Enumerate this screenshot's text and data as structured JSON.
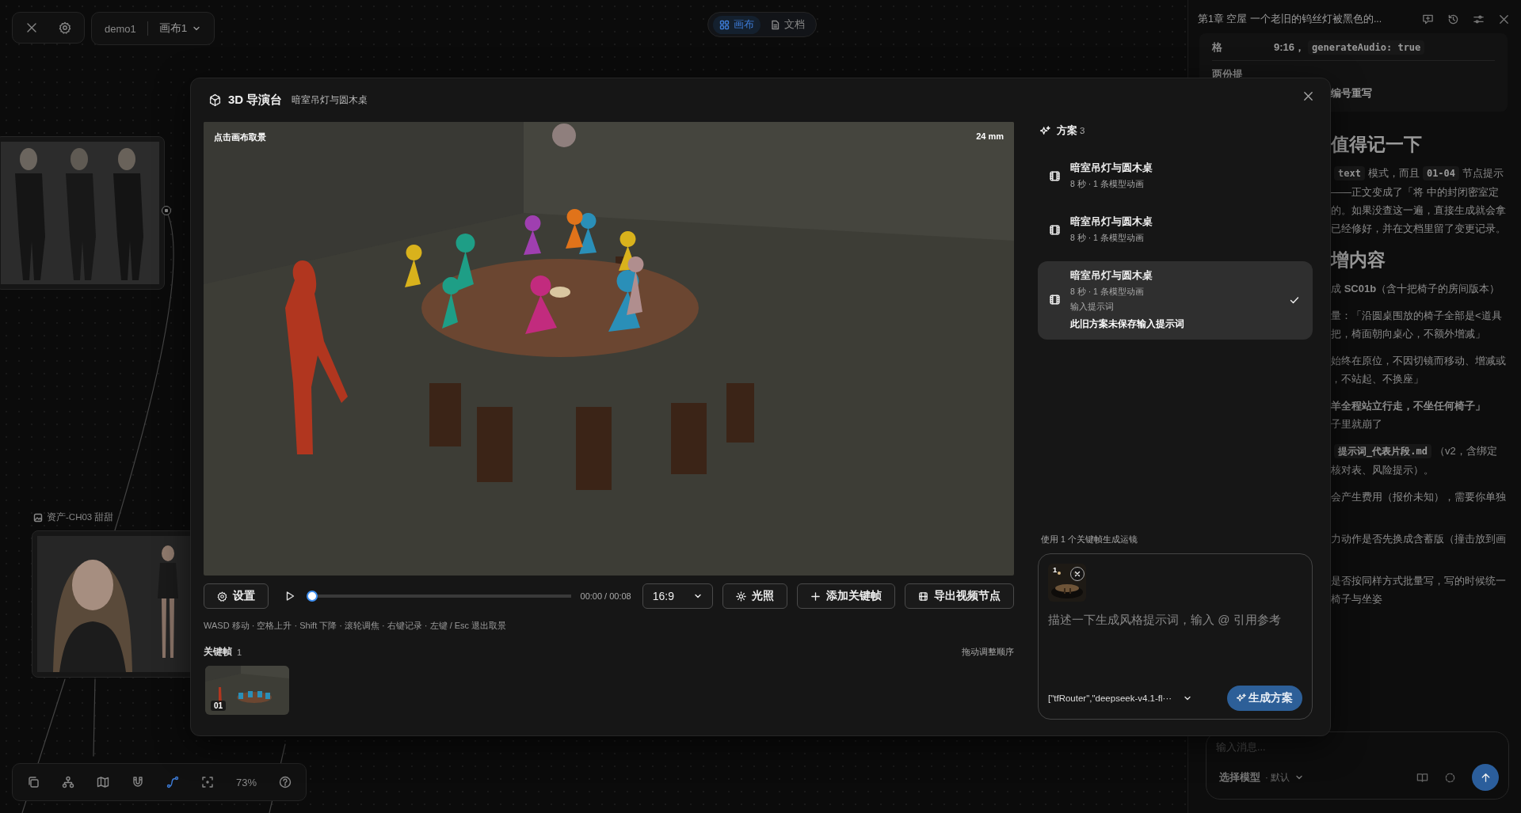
{
  "canvas": {
    "project": {
      "name": "demo1",
      "canvas": "画布1"
    },
    "view_tabs": [
      {
        "label": "画布",
        "kind": "canvas",
        "selected": true
      },
      {
        "label": "文档",
        "kind": "document",
        "selected": false
      }
    ],
    "asset_node": {
      "label": "资产-CH03 甜甜"
    },
    "toolbar": {
      "tools": [
        {
          "kind": "pages",
          "selected": false
        },
        {
          "kind": "tree",
          "selected": false
        },
        {
          "kind": "map",
          "selected": false
        },
        {
          "kind": "magnet",
          "selected": false
        },
        {
          "kind": "path",
          "selected": true
        },
        {
          "kind": "focus",
          "selected": false
        }
      ],
      "zoom": "73%"
    }
  },
  "modal": {
    "title": "3D 导演台",
    "subtitle": "暗室吊灯与圆木桌",
    "viewport": {
      "hint": "点击画布取景",
      "focal": "24 mm"
    },
    "controls": {
      "settings": "设置",
      "level": 0,
      "time": "00:00 / 00:08",
      "aspect": "16:9",
      "lighting": "光照",
      "add_keyframe": "添加关键帧",
      "export": "导出视频节点"
    },
    "shortcuts": "WASD 移动 · 空格上升 · Shift 下降 · 滚轮调焦 · 右键记录 · 左键 / Esc 退出取景",
    "keyframes": {
      "title": "关键帧",
      "count": "1",
      "hint": "拖动调整顺序",
      "items": [
        {
          "label": "01"
        }
      ]
    },
    "schemes": {
      "title": "方案",
      "count": "3",
      "items": [
        {
          "title": "暗室吊灯与圆木桌",
          "meta": "8 秒 · 1 条模型动画",
          "selected": false
        },
        {
          "title": "暗室吊灯与圆木桌",
          "meta": "8 秒 · 1 条模型动画",
          "selected": false
        },
        {
          "title": "暗室吊灯与圆木桌",
          "meta": "8 秒 · 1 条模型动画",
          "prompt_label": "输入提示词",
          "note": "此旧方案未保存输入提示词",
          "selected": true
        }
      ]
    },
    "composer": {
      "caption": "使用 1 个关键帧生成运镜",
      "attachments": [
        {
          "badge": "1"
        }
      ],
      "placeholder": "描述一下生成风格提示词，输入 @ 引用参考",
      "model": "[\"tfRouter\",\"deepseek-v4.1-fl···",
      "submit": "生成方案"
    }
  },
  "document": {
    "title": "第1章 空屋 一个老旧的钨丝灯被黑色的...",
    "table": [
      {
        "kind": "inline",
        "label": "格",
        "parts": [
          {
            "text": "9:16，",
            "code": false
          },
          {
            "text": "generateAudio: true",
            "code": true
          }
        ]
      },
      {
        "kind": "stacked",
        "label": "两份提",
        "parts": [
          {
            "text": "编号重写",
            "code": false
          }
        ]
      }
    ],
    "blocks": [
      {
        "kind": "heading",
        "text": "值得记一下"
      },
      {
        "kind": "paragraph",
        "lines": [
          [
            {
              "text": "text",
              "code": true
            },
            {
              "text": "模式，而且",
              "code": false
            },
            {
              "text": "01-04",
              "code": true
            },
            {
              "text": "节点提示",
              "code": false
            }
          ],
          [
            {
              "text": "——正文变成了「将  中的封闭密室定",
              "code": false
            }
          ],
          [
            {
              "text": "的。如果没查这一遍，直接生成就会拿",
              "code": false
            }
          ],
          [
            {
              "text": "已经修好，并在文档里留了变更记录。",
              "code": false
            }
          ]
        ]
      },
      {
        "kind": "heading",
        "text": "增内容"
      },
      {
        "kind": "paragraph",
        "lines": [
          [
            {
              "text": "成 **SC01b**（含十把椅子的房间版本）",
              "code": false
            }
          ]
        ]
      },
      {
        "kind": "paragraph",
        "lines": [
          [
            {
              "text": "量：「沿圆桌围放的椅子全部是<道具",
              "code": false
            }
          ],
          [
            {
              "text": "把，椅面朝向桌心，不额外增减」",
              "code": false
            }
          ]
        ]
      },
      {
        "kind": "paragraph",
        "lines": [
          [
            {
              "text": "始终在原位，不因切镜而移动、增减或",
              "code": false
            }
          ],
          [
            {
              "text": "，不站起、不换座」",
              "code": false
            }
          ]
        ]
      },
      {
        "kind": "paragraph",
        "lines": [
          [
            {
              "text": "**羊全程站立行走，不坐任何椅子」**",
              "code": false
            }
          ],
          [
            {
              "text": "子里就崩了",
              "code": false
            }
          ]
        ]
      },
      {
        "kind": "paragraph",
        "lines": [
          [
            {
              "text": "提示词_代表片段.md",
              "code": true
            },
            {
              "text": "（v2，含绑定",
              "code": false
            }
          ],
          [
            {
              "text": "核对表、风险提示）。",
              "code": false
            }
          ]
        ]
      },
      {
        "kind": "paragraph",
        "lines": [
          [
            {
              "text": "会产生费用（报价未知），需要你单独",
              "code": false
            }
          ]
        ]
      },
      {
        "kind": "paragraph",
        "lines": [
          [
            {
              "text": "力动作是否先换成含蓄版（撞击放到画",
              "code": false
            }
          ]
        ]
      },
      {
        "kind": "paragraph",
        "lines": [
          [
            {
              "text": "是否按同样方式批量写，写的时候统一",
              "code": false
            }
          ],
          [
            {
              "text": "椅子与坐姿",
              "code": false
            }
          ]
        ]
      }
    ],
    "chat": {
      "placeholder": "输入消息...",
      "model_label": "选择模型",
      "model_value": "· 默认"
    }
  }
}
